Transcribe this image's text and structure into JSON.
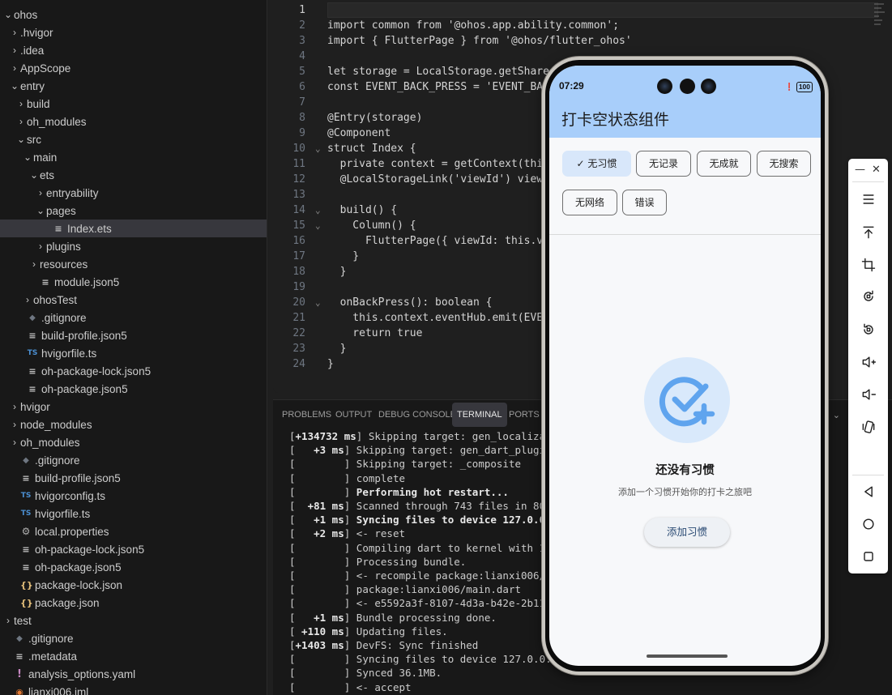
{
  "explorer": {
    "items": [
      {
        "label": "ohos",
        "chev": "⌄",
        "icon": "",
        "icon_name": "",
        "depth": 0
      },
      {
        "label": ".hvigor",
        "chev": "›",
        "icon": "",
        "icon_name": "",
        "depth": 1
      },
      {
        "label": ".idea",
        "chev": "›",
        "icon": "",
        "icon_name": "",
        "depth": 1
      },
      {
        "label": "AppScope",
        "chev": "›",
        "icon": "",
        "icon_name": "",
        "depth": 1
      },
      {
        "label": "entry",
        "chev": "⌄",
        "icon": "",
        "icon_name": "",
        "depth": 1
      },
      {
        "label": "build",
        "chev": "›",
        "icon": "",
        "icon_name": "",
        "depth": 2
      },
      {
        "label": "oh_modules",
        "chev": "›",
        "icon": "",
        "icon_name": "",
        "depth": 2
      },
      {
        "label": "src",
        "chev": "⌄",
        "icon": "",
        "icon_name": "",
        "depth": 2
      },
      {
        "label": "main",
        "chev": "⌄",
        "icon": "",
        "icon_name": "",
        "depth": 3
      },
      {
        "label": "ets",
        "chev": "⌄",
        "icon": "",
        "icon_name": "",
        "depth": 4
      },
      {
        "label": "entryability",
        "chev": "›",
        "icon": "",
        "icon_name": "",
        "depth": 5
      },
      {
        "label": "pages",
        "chev": "⌄",
        "icon": "",
        "icon_name": "",
        "depth": 5
      },
      {
        "label": "Index.ets",
        "chev": "",
        "icon": "≡",
        "icon_name": "lines-file-icon",
        "depth": 6,
        "selected": true
      },
      {
        "label": "plugins",
        "chev": "›",
        "icon": "",
        "icon_name": "",
        "depth": 5
      },
      {
        "label": "resources",
        "chev": "›",
        "icon": "",
        "icon_name": "",
        "depth": 4
      },
      {
        "label": "module.json5",
        "chev": "",
        "icon": "≡",
        "icon_name": "lines-file-icon",
        "depth": 4
      },
      {
        "label": "ohosTest",
        "chev": "›",
        "icon": "",
        "icon_name": "",
        "depth": 3
      },
      {
        "label": ".gitignore",
        "chev": "",
        "icon": "◆",
        "icon_name": "git-file-icon",
        "depth": 2
      },
      {
        "label": "build-profile.json5",
        "chev": "",
        "icon": "≡",
        "icon_name": "lines-file-icon",
        "depth": 2
      },
      {
        "label": "hvigorfile.ts",
        "chev": "",
        "icon": "TS",
        "icon_name": "typescript-file-icon",
        "depth": 2
      },
      {
        "label": "oh-package-lock.json5",
        "chev": "",
        "icon": "≡",
        "icon_name": "lines-file-icon",
        "depth": 2
      },
      {
        "label": "oh-package.json5",
        "chev": "",
        "icon": "≡",
        "icon_name": "lines-file-icon",
        "depth": 2
      },
      {
        "label": "hvigor",
        "chev": "›",
        "icon": "",
        "icon_name": "",
        "depth": 1
      },
      {
        "label": "node_modules",
        "chev": "›",
        "icon": "",
        "icon_name": "",
        "depth": 1
      },
      {
        "label": "oh_modules",
        "chev": "›",
        "icon": "",
        "icon_name": "",
        "depth": 1
      },
      {
        "label": ".gitignore",
        "chev": "",
        "icon": "◆",
        "icon_name": "git-file-icon",
        "depth": 1
      },
      {
        "label": "build-profile.json5",
        "chev": "",
        "icon": "≡",
        "icon_name": "lines-file-icon",
        "depth": 1
      },
      {
        "label": "hvigorconfig.ts",
        "chev": "",
        "icon": "TS",
        "icon_name": "typescript-file-icon",
        "depth": 1
      },
      {
        "label": "hvigorfile.ts",
        "chev": "",
        "icon": "TS",
        "icon_name": "typescript-file-icon",
        "depth": 1
      },
      {
        "label": "local.properties",
        "chev": "",
        "icon": "⚙",
        "icon_name": "gear-file-icon",
        "depth": 1
      },
      {
        "label": "oh-package-lock.json5",
        "chev": "",
        "icon": "≡",
        "icon_name": "lines-file-icon",
        "depth": 1
      },
      {
        "label": "oh-package.json5",
        "chev": "",
        "icon": "≡",
        "icon_name": "lines-file-icon",
        "depth": 1
      },
      {
        "label": "package-lock.json",
        "chev": "",
        "icon": "{}",
        "icon_name": "json-file-icon",
        "depth": 1
      },
      {
        "label": "package.json",
        "chev": "",
        "icon": "{}",
        "icon_name": "json-file-icon",
        "depth": 1
      },
      {
        "label": "test",
        "chev": "›",
        "icon": "",
        "icon_name": "",
        "depth": 0
      },
      {
        "label": ".gitignore",
        "chev": "",
        "icon": "◆",
        "icon_name": "git-file-icon",
        "depth": 0
      },
      {
        "label": ".metadata",
        "chev": "",
        "icon": "≡",
        "icon_name": "lines-file-icon",
        "depth": 0
      },
      {
        "label": "analysis_options.yaml",
        "chev": "",
        "icon": "!",
        "icon_name": "yaml-file-icon",
        "depth": 0
      },
      {
        "label": "lianxi006.iml",
        "chev": "",
        "icon": "◉",
        "icon_name": "rss-file-icon",
        "depth": 0
      }
    ]
  },
  "editor": {
    "lines": [
      {
        "n": "1",
        "fold": "",
        "code": ""
      },
      {
        "n": "2",
        "fold": "",
        "code": "import common from '@ohos.app.ability.common';"
      },
      {
        "n": "3",
        "fold": "",
        "code": "import { FlutterPage } from '@ohos/flutter_ohos'"
      },
      {
        "n": "4",
        "fold": "",
        "code": ""
      },
      {
        "n": "5",
        "fold": "",
        "code": "let storage = LocalStorage.getShared"
      },
      {
        "n": "6",
        "fold": "",
        "code": "const EVENT_BACK_PRESS = 'EVENT_BAC"
      },
      {
        "n": "7",
        "fold": "",
        "code": ""
      },
      {
        "n": "8",
        "fold": "",
        "code": "@Entry(storage)"
      },
      {
        "n": "9",
        "fold": "",
        "code": "@Component"
      },
      {
        "n": "10",
        "fold": "⌄",
        "code": "struct Index {"
      },
      {
        "n": "11",
        "fold": "",
        "code": "  private context = getContext(this"
      },
      {
        "n": "12",
        "fold": "",
        "code": "  @LocalStorageLink('viewId') viewI"
      },
      {
        "n": "13",
        "fold": "",
        "code": ""
      },
      {
        "n": "14",
        "fold": "⌄",
        "code": "  build() {"
      },
      {
        "n": "15",
        "fold": "⌄",
        "code": "    Column() {"
      },
      {
        "n": "16",
        "fold": "",
        "code": "      FlutterPage({ viewId: this.vi"
      },
      {
        "n": "17",
        "fold": "",
        "code": "    }"
      },
      {
        "n": "18",
        "fold": "",
        "code": "  }"
      },
      {
        "n": "19",
        "fold": "",
        "code": ""
      },
      {
        "n": "20",
        "fold": "⌄",
        "code": "  onBackPress(): boolean {"
      },
      {
        "n": "21",
        "fold": "",
        "code": "    this.context.eventHub.emit(EVEN"
      },
      {
        "n": "22",
        "fold": "",
        "code": "    return true"
      },
      {
        "n": "23",
        "fold": "",
        "code": "  }"
      },
      {
        "n": "24",
        "fold": "",
        "code": "}"
      }
    ]
  },
  "panel": {
    "tabs": [
      "PROBLEMS",
      "OUTPUT",
      "DEBUG CONSOLE",
      "TERMINAL",
      "PORTS"
    ],
    "active_tab": "TERMINAL",
    "terminal": [
      {
        "t": "[",
        "ms": "+134732 ms",
        "msg": " Skipping target: gen_localizatic",
        "bold": false
      },
      {
        "t": "[",
        "ms": "   +3 ms",
        "msg": " Skipping target: gen_dart_plugin_r",
        "bold": false
      },
      {
        "t": "[",
        "ms": "        ",
        "msg": " Skipping target: _composite",
        "bold": false
      },
      {
        "t": "[",
        "ms": "        ",
        "msg": " complete",
        "bold": false
      },
      {
        "t": "[",
        "ms": "        ",
        "msg": " Performing hot restart...",
        "bold": true
      },
      {
        "t": "[",
        "ms": "  +81 ms",
        "msg": " Scanned through 743 files in 80ms",
        "bold": false
      },
      {
        "t": "[",
        "ms": "   +1 ms",
        "msg": " Syncing files to device 127.0.0.1:",
        "bold": true
      },
      {
        "t": "[",
        "ms": "   +2 ms",
        "msg": " <- reset",
        "bold": false
      },
      {
        "t": "[",
        "ms": "        ",
        "msg": " Compiling dart to kernel with 1 up",
        "bold": false
      },
      {
        "t": "[",
        "ms": "        ",
        "msg": " Processing bundle.",
        "bold": false
      },
      {
        "t": "[",
        "ms": "        ",
        "msg": " <- recompile package:lianxi006/mai",
        "bold": false
      },
      {
        "t": "[",
        "ms": "        ",
        "msg": " package:lianxi006/main.dart",
        "bold": false
      },
      {
        "t": "[",
        "ms": "        ",
        "msg": " <- e5592a3f-8107-4d3a-b42e-2b11535",
        "bold": false
      },
      {
        "t": "[",
        "ms": "   +1 ms",
        "msg": " Bundle processing done.",
        "bold": false
      },
      {
        "t": "[",
        "ms": " +110 ms",
        "msg": " Updating files.",
        "bold": false
      },
      {
        "t": "[",
        "ms": "+1403 ms",
        "msg": " DevFS: Sync finished",
        "bold": false
      },
      {
        "t": "[",
        "ms": "        ",
        "msg": " Syncing files to device 127.0.0.1:",
        "bold": false
      },
      {
        "t": "[",
        "ms": "        ",
        "msg": " Synced 36.1MB.",
        "bold": false
      },
      {
        "t": "[",
        "ms": "        ",
        "msg": " <- accept",
        "bold": false
      }
    ]
  },
  "phone": {
    "status_time": "07:29",
    "battery": "100",
    "app_title": "打卡空状态组件",
    "chips": [
      {
        "label": "无习惯",
        "selected": true
      },
      {
        "label": "无记录",
        "selected": false
      },
      {
        "label": "无成就",
        "selected": false
      },
      {
        "label": "无搜索",
        "selected": false
      },
      {
        "label": "无网络",
        "selected": false
      },
      {
        "label": "错误",
        "selected": false
      }
    ],
    "empty_title": "还没有习惯",
    "empty_subtitle": "添加一个习惯开始你的打卡之旅吧",
    "add_button": "添加习惯",
    "accent": "#5fa4ee",
    "appbar_color": "#a8cefa"
  },
  "emulator_toolbar": {
    "minimize": "—",
    "close": "✕",
    "buttons": [
      "menu-icon",
      "pin-top-icon",
      "crop-icon",
      "rotate-left-icon",
      "rotate-right-icon",
      "volume-up-icon",
      "volume-down-icon",
      "shake-icon",
      "back-icon",
      "home-icon",
      "recents-icon"
    ]
  }
}
